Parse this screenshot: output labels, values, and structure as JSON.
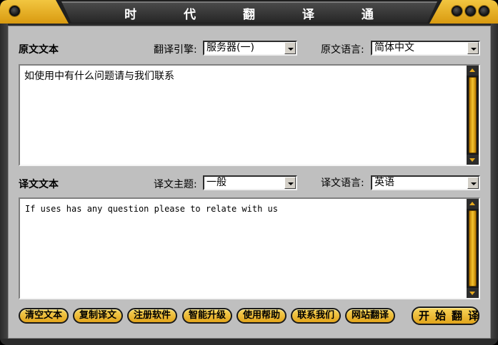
{
  "window": {
    "title": "时 代 翻 译 通",
    "accent_color": "#e6a91e",
    "title_buttons": [
      "window-control-left",
      "minimize",
      "maximize",
      "close"
    ]
  },
  "source": {
    "section_label": "原文文本",
    "engine_label": "翻译引擎:",
    "engine_value": "服务器(一)",
    "language_label": "原文语言:",
    "language_value": "简体中文",
    "text": "如使用中有什么问题请与我们联系"
  },
  "target": {
    "section_label": "译文文本",
    "topic_label": "译文主题:",
    "topic_value": "一般",
    "language_label": "译文语言:",
    "language_value": "英语",
    "text": "If uses has any question please to relate with us"
  },
  "buttons": {
    "clear": "清空文本",
    "copy": "复制译文",
    "register": "注册软件",
    "upgrade": "智能升级",
    "help": "使用帮助",
    "contact": "联系我们",
    "web_translate": "网站翻译",
    "start": "开始翻译"
  }
}
